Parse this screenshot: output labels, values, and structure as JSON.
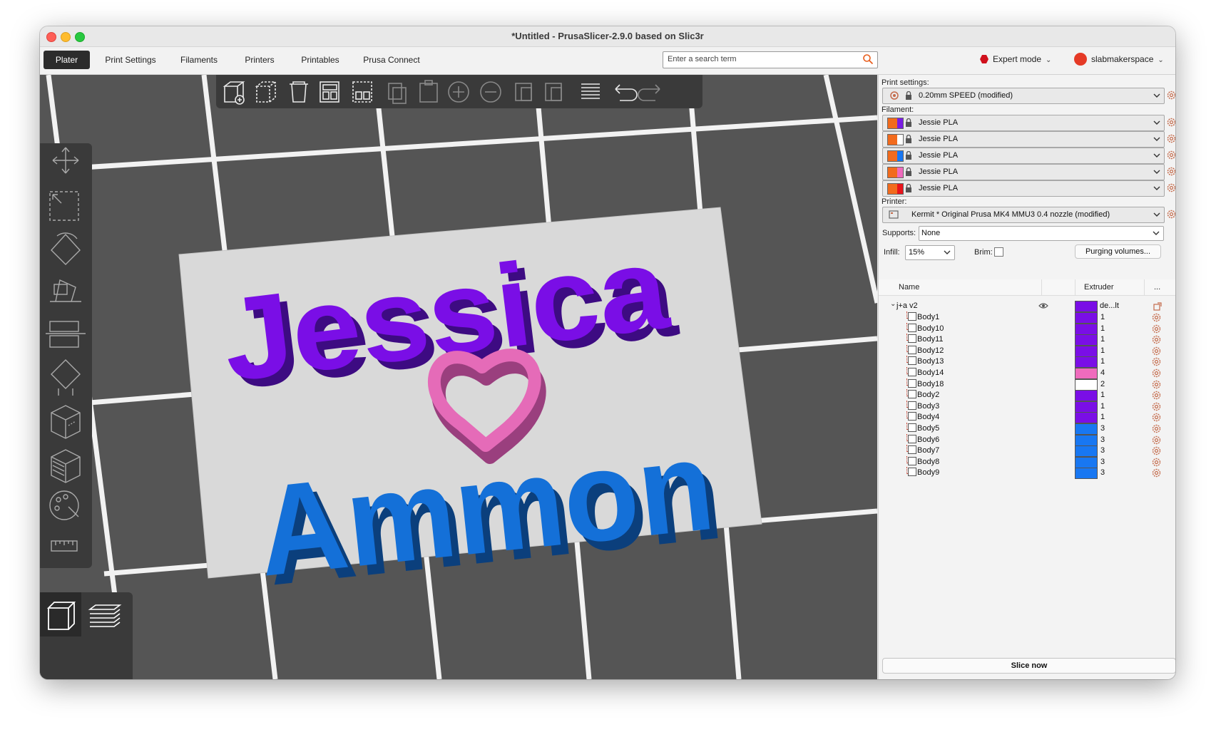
{
  "window": {
    "title": "*Untitled - PrusaSlicer-2.9.0 based on Slic3r"
  },
  "tabs": [
    "Plater",
    "Print Settings",
    "Filaments",
    "Printers",
    "Printables",
    "Prusa Connect"
  ],
  "search": {
    "placeholder": "Enter a search term"
  },
  "mode": {
    "label": "Expert mode"
  },
  "account": {
    "label": "slabmakerspace"
  },
  "sidebar": {
    "print_settings_label": "Print settings:",
    "print_profile": "0.20mm SPEED (modified)",
    "filament_label": "Filament:",
    "filaments": [
      {
        "name": "Jessie PLA",
        "color_a": "#f26b1d",
        "color_b": "#7a1de3"
      },
      {
        "name": "Jessie PLA",
        "color_a": "#f26b1d",
        "color_b": "#ffffff"
      },
      {
        "name": "Jessie PLA",
        "color_a": "#f26b1d",
        "color_b": "#1877f2"
      },
      {
        "name": "Jessie PLA",
        "color_a": "#f26b1d",
        "color_b": "#ef6bbd"
      },
      {
        "name": "Jessie PLA",
        "color_a": "#f26b1d",
        "color_b": "#e8141c"
      }
    ],
    "printer_label": "Printer:",
    "printer_profile": "Kermit * Original Prusa MK4 MMU3 0.4 nozzle (modified)",
    "supports_label": "Supports:",
    "supports_value": "None",
    "infill_label": "Infill:",
    "infill_value": "15%",
    "brim_label": "Brim:",
    "purging_button": "Purging volumes...",
    "col_name": "Name",
    "col_extruder": "Extruder",
    "col_more": "...",
    "object": {
      "name": "j+a v2",
      "extruder": "de...lt",
      "color": "#7a0ee6"
    },
    "parts": [
      {
        "name": "Body1",
        "extruder": "1",
        "color": "#7a0ee6"
      },
      {
        "name": "Body10",
        "extruder": "1",
        "color": "#7a0ee6"
      },
      {
        "name": "Body11",
        "extruder": "1",
        "color": "#7a0ee6"
      },
      {
        "name": "Body12",
        "extruder": "1",
        "color": "#7a0ee6"
      },
      {
        "name": "Body13",
        "extruder": "1",
        "color": "#7a0ee6"
      },
      {
        "name": "Body14",
        "extruder": "4",
        "color": "#ef6bbd"
      },
      {
        "name": "Body18",
        "extruder": "2",
        "color": "#ffffff"
      },
      {
        "name": "Body2",
        "extruder": "1",
        "color": "#7a0ee6"
      },
      {
        "name": "Body3",
        "extruder": "1",
        "color": "#7a0ee6"
      },
      {
        "name": "Body4",
        "extruder": "1",
        "color": "#7a0ee6"
      },
      {
        "name": "Body5",
        "extruder": "3",
        "color": "#1877f2"
      },
      {
        "name": "Body6",
        "extruder": "3",
        "color": "#1877f2"
      },
      {
        "name": "Body7",
        "extruder": "3",
        "color": "#1877f2"
      },
      {
        "name": "Body8",
        "extruder": "3",
        "color": "#1877f2"
      },
      {
        "name": "Body9",
        "extruder": "3",
        "color": "#1877f2"
      }
    ],
    "slice_button": "Slice now"
  },
  "scene": {
    "text_top": "Jessica",
    "text_bottom": "Ammon",
    "color_top": "#7a0ee6",
    "color_heart": "#e56bb8",
    "color_bottom": "#1470d8",
    "plate_color": "#d9d9d9"
  },
  "icons": {
    "top_toolbar": [
      "add-icon",
      "delete-icon",
      "delete-all-icon",
      "arrange-icon",
      "arrange-selection-icon",
      "copy-icon",
      "paste-icon",
      "add-instance-icon",
      "remove-instance-icon",
      "split-objects-icon",
      "split-parts-icon",
      "layers-editing-icon",
      "undo-icon",
      "redo-icon"
    ],
    "left_toolbar": [
      "move-icon",
      "scale-icon",
      "rotate-icon",
      "place-on-face-icon",
      "cut-icon",
      "supports-paint-icon",
      "seam-paint-icon",
      "fuzzy-skin-icon",
      "mmu-paint-icon",
      "measure-icon"
    ],
    "view_toggle": [
      "3d-view-icon",
      "preview-icon"
    ]
  }
}
